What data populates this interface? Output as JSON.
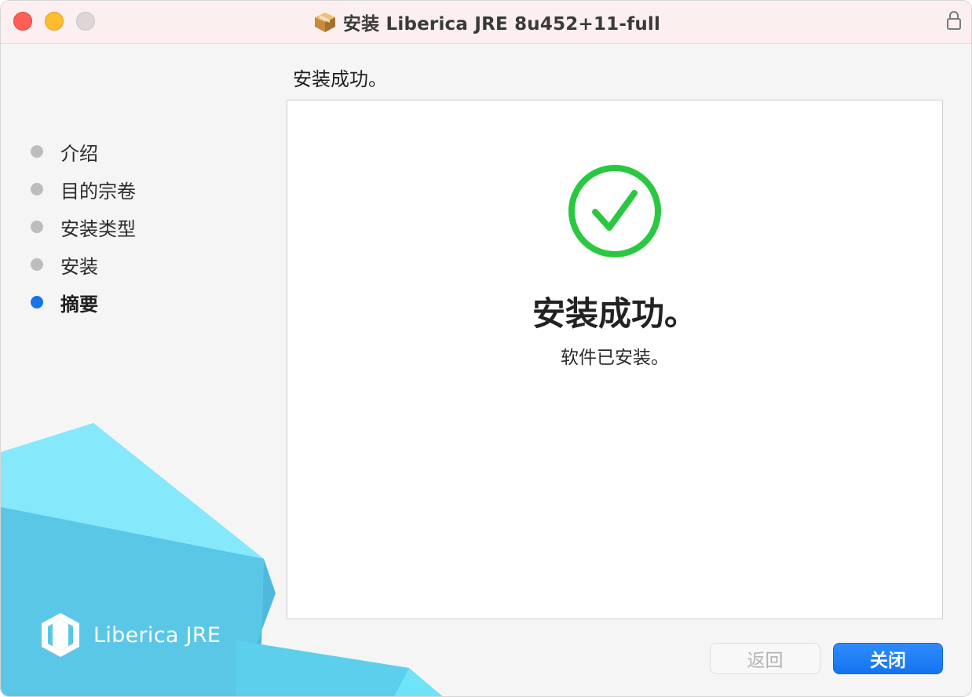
{
  "window": {
    "title": "安装 Liberica JRE 8u452+11-full"
  },
  "sidebar": {
    "steps": [
      {
        "label": "介绍",
        "active": false
      },
      {
        "label": "目的宗卷",
        "active": false
      },
      {
        "label": "安装类型",
        "active": false
      },
      {
        "label": "安装",
        "active": false
      },
      {
        "label": "摘要",
        "active": true
      }
    ],
    "brand": "Liberica JRE"
  },
  "content": {
    "heading": "安装成功。",
    "success_title": "安装成功。",
    "success_message": "软件已安装。"
  },
  "buttons": {
    "back_label": "返回",
    "close_label": "关闭"
  },
  "icons": {
    "package": "package-icon",
    "lock": "lock-icon",
    "success": "checkmark-circle-icon",
    "logo": "liberica-logo-icon"
  },
  "colors": {
    "accent": "#1a73e8",
    "success": "#2ac840",
    "brand_cyan": "#5fdcf5"
  }
}
